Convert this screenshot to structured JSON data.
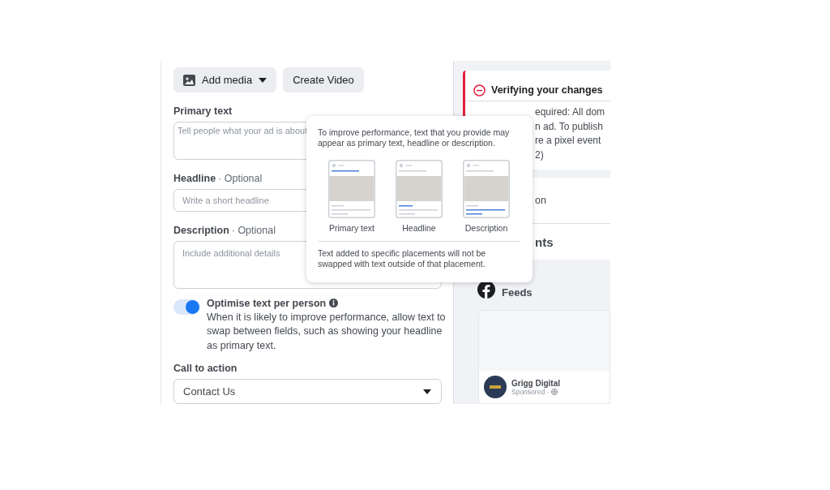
{
  "media_buttons": [
    {
      "label": "Add media",
      "kind": "dropdown"
    },
    {
      "label": "Create Video",
      "kind": "plain"
    }
  ],
  "fields": [
    {
      "label": "Primary text",
      "placeholder": "Tell people what your ad is about",
      "kind": "textarea"
    },
    {
      "label": "Headline",
      "optional": "· Optional",
      "placeholder": "Write a short headline",
      "kind": "input"
    },
    {
      "label": "Description",
      "optional": "· Optional",
      "placeholder": "Include additional details",
      "kind": "textarea"
    }
  ],
  "optimise": {
    "on": true,
    "title": "Optimise text per person",
    "description": "When it is likely to improve performance, allow text to swap between fields, such as showing your headline as primary text."
  },
  "call_to_action": {
    "label": "Call to action",
    "value": "Contact Us"
  },
  "tooltip": {
    "intro": "To improve performance, text that you provide may appear as primary text, headline or description.",
    "placements": [
      {
        "label": "Primary text",
        "kind": "primary"
      },
      {
        "label": "Headline",
        "kind": "headline"
      },
      {
        "label": "Description",
        "kind": "description"
      }
    ],
    "note": "Text added to specific placements will not be swapped with text outside of that placement."
  },
  "verify": {
    "title": "Verifying your changes",
    "lines": [
      "equired: All dom",
      "n ad. To publish",
      "re a pixel event",
      "2)"
    ]
  },
  "section_fragment": "on",
  "placements_fragment": "nts",
  "feed": {
    "title": "Feeds",
    "page_name": "Grigg Digital",
    "sponsored": "Sponsored ·"
  }
}
